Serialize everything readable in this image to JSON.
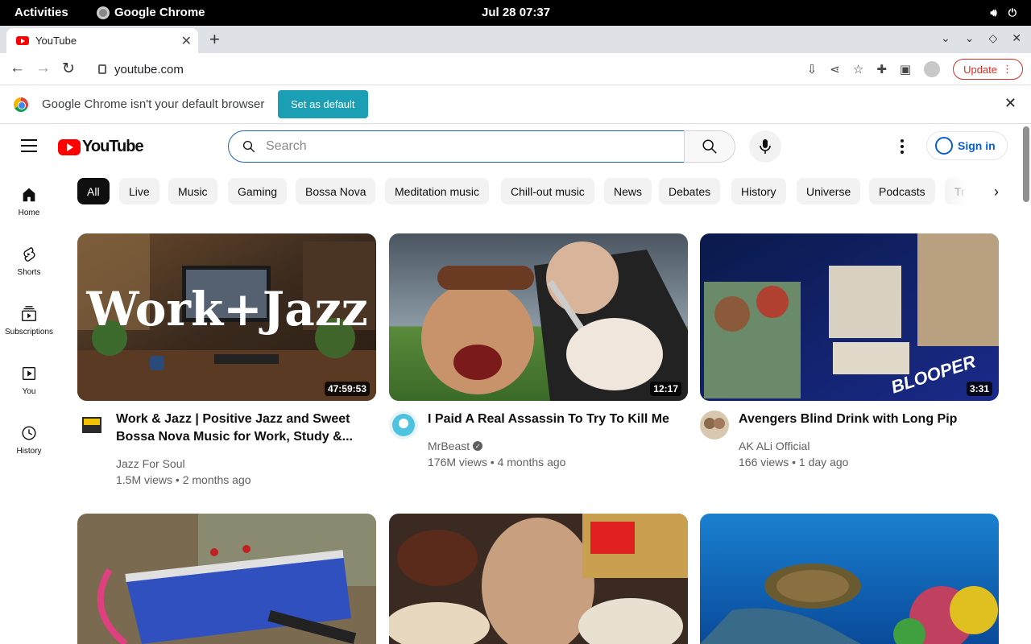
{
  "system_bar": {
    "activities": "Activities",
    "app_name": "Google Chrome",
    "clock": "Jul 28  07:37"
  },
  "browser": {
    "tab_title": "YouTube",
    "url": "youtube.com",
    "update_label": "Update",
    "infobar_message": "Google Chrome isn't your default browser",
    "set_default_label": "Set as default"
  },
  "youtube": {
    "logo_text": "YouTube",
    "search_placeholder": "Search",
    "signin_label": "Sign in",
    "guide": [
      {
        "label": "Home",
        "icon": "home-icon"
      },
      {
        "label": "Shorts",
        "icon": "shorts-icon"
      },
      {
        "label": "Subscriptions",
        "icon": "subscriptions-icon"
      },
      {
        "label": "You",
        "icon": "you-icon"
      },
      {
        "label": "History",
        "icon": "history-icon"
      }
    ],
    "chips": [
      "All",
      "Live",
      "Music",
      "Gaming",
      "Bossa Nova",
      "Meditation music",
      "Chill-out music",
      "News",
      "Debates",
      "History",
      "Universe",
      "Podcasts",
      "Tr"
    ],
    "videos": [
      {
        "title": "Work & Jazz | Positive Jazz and Sweet Bossa Nova Music for Work, Study &...",
        "channel": "Jazz For Soul",
        "stats": "1.5M views • 2 months ago",
        "duration": "47:59:53",
        "thumb_text": "Work+Jazz",
        "verified": false
      },
      {
        "title": "I Paid A Real Assassin To Try To Kill Me",
        "channel": "MrBeast",
        "stats": "176M views • 4 months ago",
        "duration": "12:17",
        "verified": true
      },
      {
        "title": "Avengers Blind Drink with Long Pip",
        "channel": "AK ALi Official",
        "stats": "166 views • 1 day ago",
        "duration": "3:31",
        "thumb_text": "BLOOPER",
        "verified": false
      }
    ]
  },
  "colors": {
    "yt_red": "#ff0000",
    "link_blue": "#065fd4",
    "set_default_bg": "#1a9fb5",
    "update_red": "#d93025"
  }
}
